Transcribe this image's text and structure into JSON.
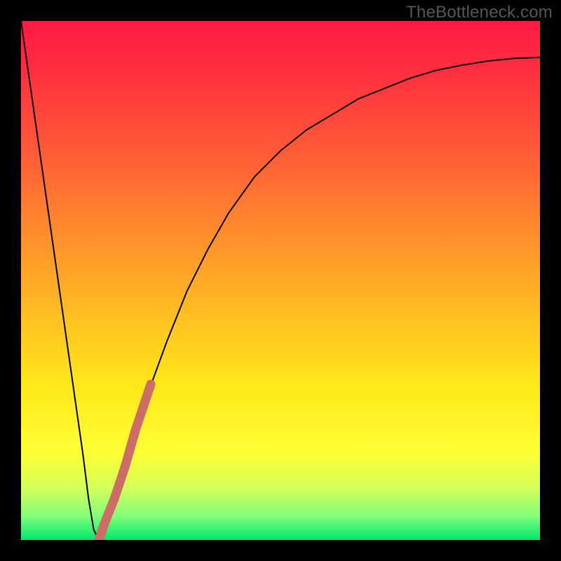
{
  "watermark": "TheBottleneck.com",
  "colors": {
    "frame": "#000000",
    "text": "#565656",
    "curve_stroke": "#000000",
    "overlay_stroke": "#cc6d66",
    "gradient_stops": [
      {
        "offset": 0.0,
        "color": "#ff1a44"
      },
      {
        "offset": 0.1,
        "color": "#ff2f3f"
      },
      {
        "offset": 0.25,
        "color": "#ff5a36"
      },
      {
        "offset": 0.4,
        "color": "#ff8a2d"
      },
      {
        "offset": 0.55,
        "color": "#ffb922"
      },
      {
        "offset": 0.7,
        "color": "#ffe71a"
      },
      {
        "offset": 0.83,
        "color": "#ffff33"
      },
      {
        "offset": 0.9,
        "color": "#d4ff5a"
      },
      {
        "offset": 0.955,
        "color": "#7fff7a"
      },
      {
        "offset": 1.0,
        "color": "#00e66e"
      }
    ]
  },
  "chart_data": {
    "type": "line",
    "title": "",
    "xlabel": "",
    "ylabel": "",
    "xlim": [
      0,
      100
    ],
    "ylim": [
      0,
      100
    ],
    "series": [
      {
        "name": "bottleneck-curve",
        "x": [
          0,
          2,
          4,
          6,
          8,
          10,
          12,
          13,
          14,
          15,
          16,
          20,
          24,
          28,
          32,
          36,
          40,
          45,
          50,
          55,
          60,
          65,
          70,
          75,
          80,
          85,
          90,
          95,
          100
        ],
        "y": [
          100,
          86,
          72,
          58,
          44,
          30,
          16,
          8,
          2,
          0,
          3,
          14,
          27,
          38,
          48,
          56,
          63,
          70,
          75,
          79,
          82,
          85,
          87,
          89,
          90.5,
          91.5,
          92.3,
          92.8,
          93
        ]
      },
      {
        "name": "highlight-segment",
        "x": [
          15,
          16,
          18,
          20,
          22,
          24,
          25
        ],
        "y": [
          0,
          3,
          8,
          14,
          21,
          27,
          30
        ]
      }
    ],
    "annotations": []
  }
}
